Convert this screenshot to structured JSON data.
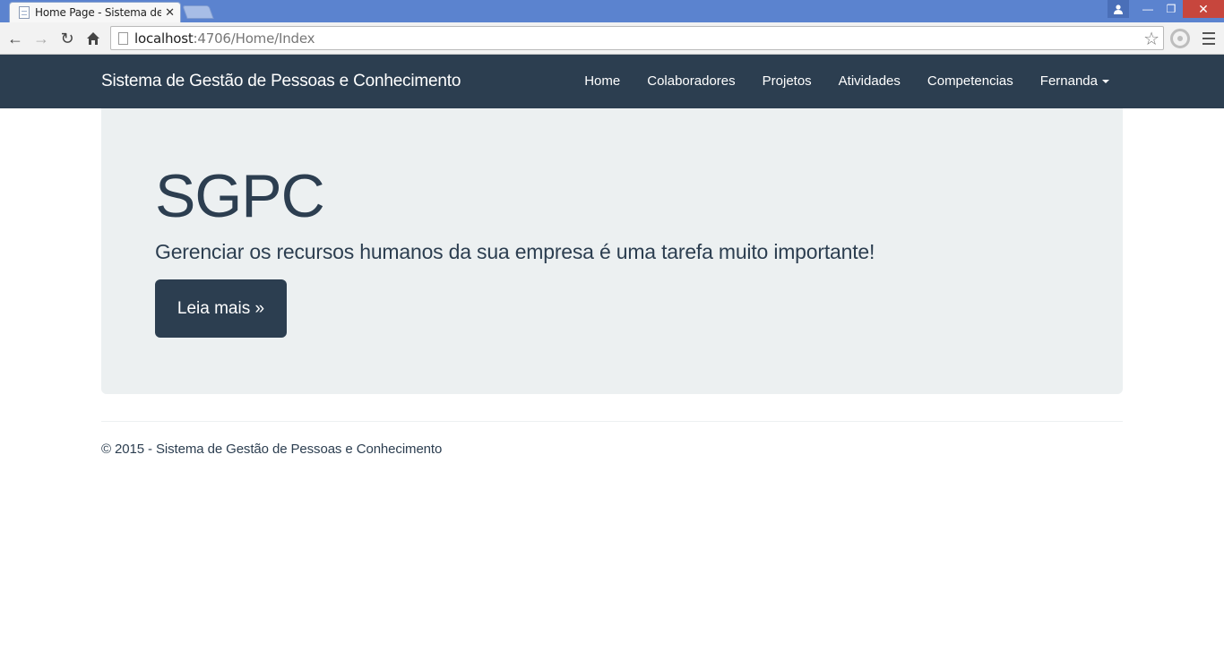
{
  "browser": {
    "tab_title": "Home Page - Sistema de G",
    "tab_close": "✕",
    "url_host": "localhost",
    "url_path": ":4706/Home/Index",
    "icons": {
      "back": "←",
      "forward": "→",
      "reload": "↻",
      "home": "⌂",
      "star": "☆",
      "user": "👤",
      "minimize": "—",
      "maximize": "❐",
      "close": "✕"
    }
  },
  "navbar": {
    "brand": "Sistema de Gestão de Pessoas e Conhecimento",
    "links": [
      "Home",
      "Colaboradores",
      "Projetos",
      "Atividades",
      "Competencias"
    ],
    "user_menu": "Fernanda"
  },
  "jumbotron": {
    "title": "SGPC",
    "lead": "Gerenciar os recursos humanos da sua empresa é uma tarefa muito importante!",
    "button": "Leia mais »"
  },
  "footer": {
    "text": "© 2015 - Sistema de Gestão de Pessoas e Conhecimento"
  },
  "colors": {
    "navbar": "#2c3e50",
    "jumbotron": "#ecf0f1",
    "titlebar": "#5b83cf"
  }
}
